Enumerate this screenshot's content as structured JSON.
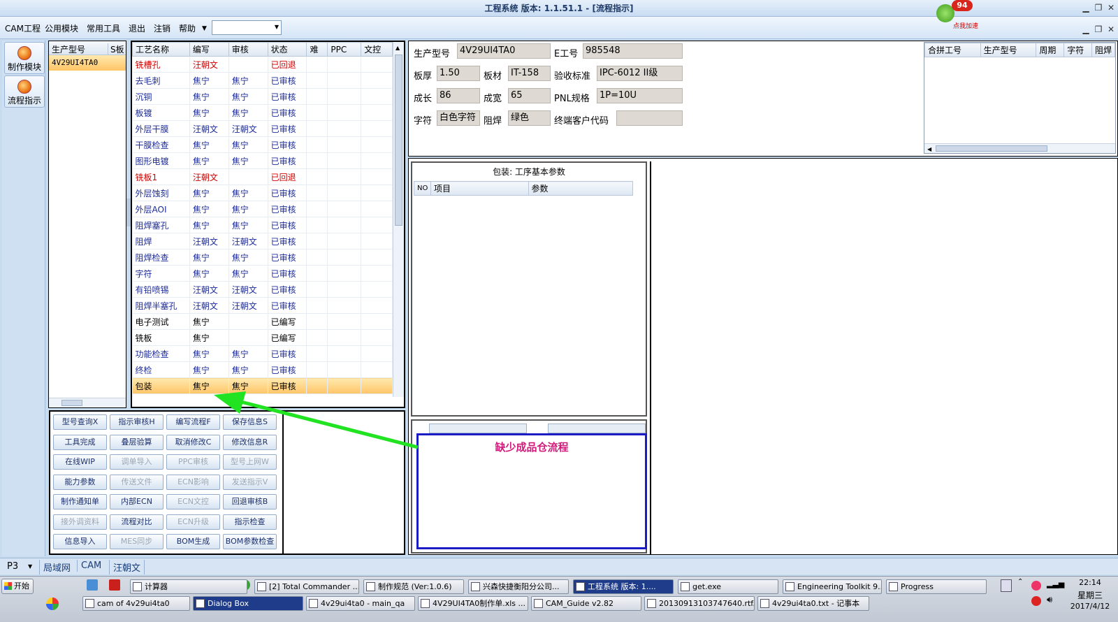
{
  "window": {
    "title": "工程系统  版本: 1.1.51.1 - [流程指示]"
  },
  "badge": {
    "count": "94",
    "label": "点我加速"
  },
  "menu": [
    "CAM工程",
    "公用模块",
    "常用工具",
    "退出",
    "注销",
    "帮助"
  ],
  "nav": [
    {
      "label": "制作模块"
    },
    {
      "label": "流程指示"
    }
  ],
  "model_list": {
    "headers": [
      "生产型号",
      "S板"
    ],
    "rows": [
      "4V29UI4TA0"
    ]
  },
  "process": {
    "headers": [
      "工艺名称",
      "编写",
      "审核",
      "状态",
      "难",
      "PPC",
      "文控"
    ],
    "rows": [
      {
        "name": "铣槽孔",
        "writer": "汪朝文",
        "reviewer": "",
        "status": "已回退",
        "color": "red"
      },
      {
        "name": "去毛刺",
        "writer": "焦宁",
        "reviewer": "焦宁",
        "status": "已审核",
        "color": "blue"
      },
      {
        "name": "沉铜",
        "writer": "焦宁",
        "reviewer": "焦宁",
        "status": "已审核",
        "color": "blue"
      },
      {
        "name": "板镀",
        "writer": "焦宁",
        "reviewer": "焦宁",
        "status": "已审核",
        "color": "blue"
      },
      {
        "name": "外层干膜",
        "writer": "汪朝文",
        "reviewer": "汪朝文",
        "status": "已审核",
        "color": "blue"
      },
      {
        "name": "干膜检查",
        "writer": "焦宁",
        "reviewer": "焦宁",
        "status": "已审核",
        "color": "blue"
      },
      {
        "name": "图形电镀",
        "writer": "焦宁",
        "reviewer": "焦宁",
        "status": "已审核",
        "color": "blue"
      },
      {
        "name": "铣板1",
        "writer": "汪朝文",
        "reviewer": "",
        "status": "已回退",
        "color": "red"
      },
      {
        "name": "外层蚀刻",
        "writer": "焦宁",
        "reviewer": "焦宁",
        "status": "已审核",
        "color": "blue"
      },
      {
        "name": "外层AOI",
        "writer": "焦宁",
        "reviewer": "焦宁",
        "status": "已审核",
        "color": "blue"
      },
      {
        "name": "阻焊塞孔",
        "writer": "焦宁",
        "reviewer": "焦宁",
        "status": "已审核",
        "color": "blue"
      },
      {
        "name": "阻焊",
        "writer": "汪朝文",
        "reviewer": "汪朝文",
        "status": "已审核",
        "color": "blue"
      },
      {
        "name": "阻焊检查",
        "writer": "焦宁",
        "reviewer": "焦宁",
        "status": "已审核",
        "color": "blue"
      },
      {
        "name": "字符",
        "writer": "焦宁",
        "reviewer": "焦宁",
        "status": "已审核",
        "color": "blue"
      },
      {
        "name": "有铅喷锡",
        "writer": "汪朝文",
        "reviewer": "汪朝文",
        "status": "已审核",
        "color": "blue"
      },
      {
        "name": "阻焊半塞孔",
        "writer": "汪朝文",
        "reviewer": "汪朝文",
        "status": "已审核",
        "color": "blue"
      },
      {
        "name": "电子测试",
        "writer": "焦宁",
        "reviewer": "",
        "status": "已编写",
        "color": "black"
      },
      {
        "name": "铣板",
        "writer": "焦宁",
        "reviewer": "",
        "status": "已编写",
        "color": "black"
      },
      {
        "name": "功能检查",
        "writer": "焦宁",
        "reviewer": "焦宁",
        "status": "已审核",
        "color": "blue"
      },
      {
        "name": "终检",
        "writer": "焦宁",
        "reviewer": "焦宁",
        "status": "已审核",
        "color": "blue"
      },
      {
        "name": "包装",
        "writer": "焦宁",
        "reviewer": "焦宁",
        "status": "已审核",
        "color": "black",
        "selected": true
      }
    ]
  },
  "buttons": [
    [
      {
        "label": "型号查询X",
        "enabled": true
      },
      {
        "label": "指示审核H",
        "enabled": true
      },
      {
        "label": "编写流程F",
        "enabled": true
      },
      {
        "label": "保存信息S",
        "enabled": true
      }
    ],
    [
      {
        "label": "工具完成",
        "enabled": true
      },
      {
        "label": "叠层验算",
        "enabled": true
      },
      {
        "label": "取消修改C",
        "enabled": true
      },
      {
        "label": "修改信息R",
        "enabled": true
      }
    ],
    [
      {
        "label": "在线WIP",
        "enabled": true
      },
      {
        "label": "调单导入",
        "enabled": false
      },
      {
        "label": "PPC审核",
        "enabled": false
      },
      {
        "label": "型号上网W",
        "enabled": false
      }
    ],
    [
      {
        "label": "能力参数",
        "enabled": true
      },
      {
        "label": "传送文件",
        "enabled": false
      },
      {
        "label": "ECN影响",
        "enabled": false
      },
      {
        "label": "发送指示V",
        "enabled": false
      }
    ],
    [
      {
        "label": "制作通知单",
        "enabled": true
      },
      {
        "label": "内部ECN",
        "enabled": true
      },
      {
        "label": "ECN文控",
        "enabled": false
      },
      {
        "label": "回退审核B",
        "enabled": true
      }
    ],
    [
      {
        "label": "接外调资料",
        "enabled": false
      },
      {
        "label": "流程对比",
        "enabled": true
      },
      {
        "label": "ECN升级",
        "enabled": false
      },
      {
        "label": "指示检查",
        "enabled": true
      }
    ],
    [
      {
        "label": "信息导入",
        "enabled": true
      },
      {
        "label": "MES同步",
        "enabled": false
      },
      {
        "label": "BOM生成",
        "enabled": true
      },
      {
        "label": "BOM参数检查",
        "enabled": true
      }
    ]
  ],
  "info": {
    "model_label": "生产型号",
    "model": "4V29UI4TA0",
    "e_label": "E工号",
    "e_no": "985548",
    "thickness_label": "板厚",
    "thickness": "1.50",
    "material_label": "板材",
    "material": "IT-158",
    "standard_label": "验收标准",
    "standard": "IPC-6012 II级",
    "length_label": "成长",
    "length": "86",
    "width_label": "成宽",
    "width": "65",
    "pnl_label": "PNL规格",
    "pnl": "1P=10U",
    "char_label": "字符",
    "char": "白色字符",
    "mask_label": "阻焊",
    "mask": "绿色",
    "customer_label": "终端客户代码",
    "customer": ""
  },
  "combine": {
    "headers": [
      "合拼工号",
      "生产型号",
      "周期",
      "字符",
      "阻焊"
    ]
  },
  "params": {
    "title": "包装: 工序基本参数",
    "headers": [
      "NO",
      "项目",
      "参数"
    ]
  },
  "annotation": {
    "text": "缺少成品仓流程",
    "arrow_color": "#22e322"
  },
  "statusbar": {
    "p3": "P3",
    "items": [
      "局域网",
      "CAM",
      "汪朝文"
    ]
  },
  "taskbar": {
    "start": "开始",
    "row1": [
      "计算器",
      "[2] Total Commander ...",
      "制作规范 (Ver:1.0.6)",
      "兴森快捷衡阳分公司...",
      "工程系统  版本: 1....",
      "get.exe",
      "Engineering Toolkit 9....",
      "Progress"
    ],
    "row2": [
      "cam of 4v29ui4ta0",
      "Dialog Box",
      "4v29ui4ta0 - main_qa",
      "4V29UI4TA0制作单.xls ...",
      "CAM_Guide v2.82",
      "20130913103747640.rtf...",
      "4v29ui4ta0.txt - 记事本"
    ],
    "time": "22:14",
    "weekday": "星期三",
    "date": "2017/4/12"
  }
}
